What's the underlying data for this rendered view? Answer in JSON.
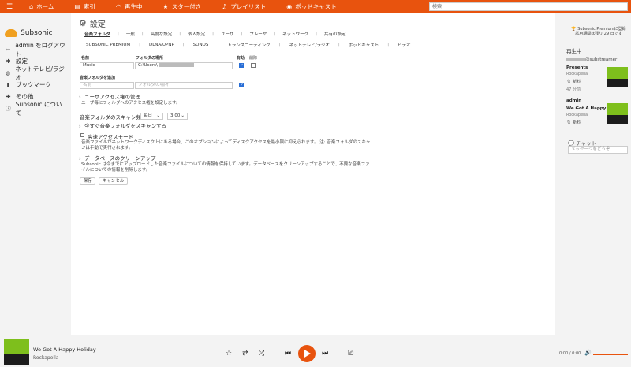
{
  "topbar": {
    "nav": [
      {
        "label": "ホーム",
        "icon": "home-icon"
      },
      {
        "label": "索引",
        "icon": "folder-icon"
      },
      {
        "label": "再生中",
        "icon": "headphones-icon"
      },
      {
        "label": "スター付き",
        "icon": "star-icon"
      },
      {
        "label": "プレイリスト",
        "icon": "music-icon"
      },
      {
        "label": "ポッドキャスト",
        "icon": "podcast-icon"
      }
    ],
    "search_placeholder": "検索"
  },
  "sidebar": {
    "brand": "Subsonic",
    "items": [
      {
        "label": "admin をログアウト"
      },
      {
        "label": "設定"
      },
      {
        "label": "ネットテレビ/ラジオ"
      },
      {
        "label": "ブックマーク"
      },
      {
        "label": "その他"
      },
      {
        "label": "Subsonic について"
      }
    ]
  },
  "main": {
    "title": "設定",
    "tabs1": [
      "音楽フォルダ",
      "一般",
      "高度な設定",
      "個人設定",
      "ユーザ",
      "プレーヤ",
      "ネットワーク",
      "共有の設定"
    ],
    "tabs2": [
      "SUBSONIC PREMIUM",
      "DLNA/UPNP",
      "SONOS",
      "トランスコーディング",
      "ネットテレビ/ラジオ",
      "ポッドキャスト",
      "ビデオ"
    ],
    "col_name": "名前",
    "col_path": "フォルダの場所",
    "col_enabled": "有効",
    "col_delete": "削除",
    "folder_name": "Music",
    "folder_path": "C:\\Users\\",
    "add_label": "音楽フォルダを追加",
    "name_placeholder": "名前",
    "path_placeholder": "フォルダの場所",
    "user_access_title": "ユーザアクセス権の管理",
    "user_access_desc": "ユーザ毎にフォルダへのアクセス権を設定します。",
    "scan_label": "音楽フォルダのスキャン頻度",
    "scan_freq": "毎日",
    "scan_time": "3:00",
    "scan_now": "今すぐ音楽フォルダをスキャンする",
    "fast_access_label": "高速アクセスモード",
    "fast_access_desc": "音楽ファイルがネットワークディスク上にある場合、このオプションによってディスクアクセスを最小限に抑えられます。 注: 音楽フォルダのスキャンは手動で実行されます。",
    "cleanup_title": "データベースのクリーンアップ",
    "cleanup_desc": "Subsonic は今までにアップロードした音楽ファイルについての情報を保持しています。データベースをクリーンアップすることで、不要な音楽ファイルについての情報を削除します。",
    "save_label": "保存",
    "cancel_label": "キャンセル"
  },
  "right": {
    "premium": "Subsonic Premiumに登録\n試用期間は残り 29 日です",
    "now_playing_title": "再生中",
    "entries": [
      {
        "user": "@substreamer",
        "song": "Presents",
        "artist": "Rockapella",
        "new": "新料",
        "time": "47 分前"
      },
      {
        "user": "admin",
        "song": "We Got A Happy ...",
        "artist": "Rockapella",
        "new": "新料",
        "time": ""
      }
    ],
    "chat_title": "チャット",
    "chat_placeholder": "メッセージをどうぞ"
  },
  "player": {
    "song": "We Got A Happy Holiday",
    "artist": "Rockapella",
    "time": "0:00 / 0:00",
    "volume": 1.0
  }
}
